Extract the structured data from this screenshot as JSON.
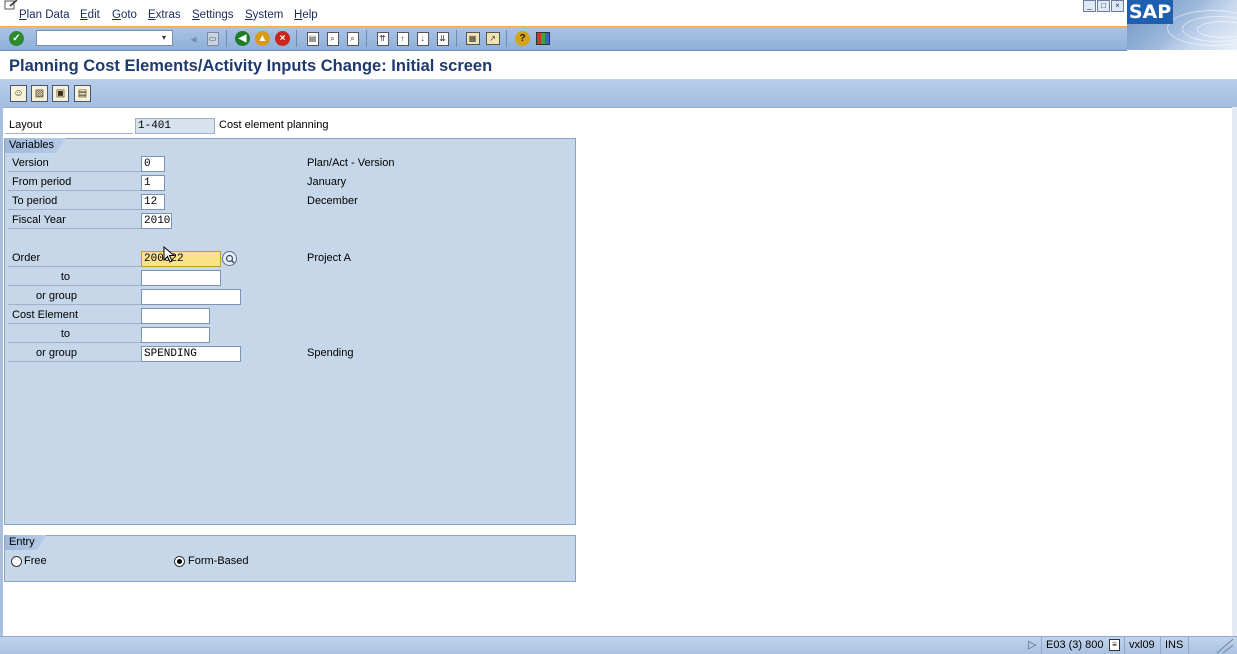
{
  "menu": {
    "items": [
      "Plan Data",
      "Edit",
      "Goto",
      "Extras",
      "Settings",
      "System",
      "Help"
    ]
  },
  "brand": {
    "logo_text": "SAP"
  },
  "title": "Planning Cost Elements/Activity Inputs Change: Initial screen",
  "layout": {
    "label": "Layout",
    "value": "1-401",
    "description": "Cost element planning"
  },
  "variables": {
    "group_title": "Variables",
    "version": {
      "label": "Version",
      "value": "0",
      "description": "Plan/Act - Version"
    },
    "from_period": {
      "label": "From period",
      "value": "1",
      "description": "January"
    },
    "to_period": {
      "label": "To period",
      "value": "12",
      "description": "December"
    },
    "fiscal_year": {
      "label": "Fiscal Year",
      "value": "2010"
    },
    "order": {
      "label": "Order",
      "value": "200022",
      "description": "Project A"
    },
    "order_to": {
      "label": "to",
      "value": ""
    },
    "order_group": {
      "label": "or group",
      "value": ""
    },
    "cost_element": {
      "label": "Cost Element",
      "value": ""
    },
    "cost_element_to": {
      "label": "to",
      "value": ""
    },
    "cost_element_group": {
      "label": "or group",
      "value": "SPENDING",
      "description": "Spending"
    }
  },
  "entry": {
    "group_title": "Entry",
    "options": [
      {
        "label": "Free",
        "selected": false
      },
      {
        "label": "Form-Based",
        "selected": true
      }
    ]
  },
  "status": {
    "system": "E03 (3) 800",
    "server": "vxl09",
    "mode": "INS"
  },
  "colors": {
    "title": "#1e3a6e",
    "focus_field": "#fae28a",
    "group_background": "#c6d7e9"
  }
}
